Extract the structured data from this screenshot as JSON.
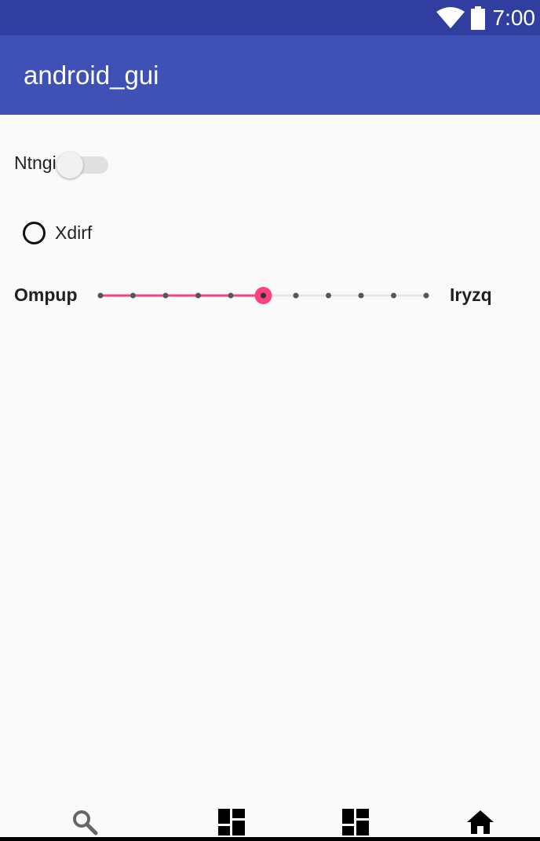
{
  "status_bar": {
    "time": "7:00",
    "icons": [
      "wifi-icon",
      "battery-icon"
    ],
    "background": "#303f9f"
  },
  "app_bar": {
    "title": "android_gui",
    "background": "#3f51b5"
  },
  "switch": {
    "label": "Ntngi",
    "checked": false
  },
  "radio": {
    "label": "Xdirf",
    "selected": false
  },
  "slider": {
    "left_label": "Ompup",
    "right_label": "Iryzq",
    "min": 0,
    "max": 10,
    "value": 5,
    "accent_color": "#ff4081"
  },
  "bottom_nav": {
    "items": [
      {
        "icon": "search-icon"
      },
      {
        "icon": "dashboard-icon"
      },
      {
        "icon": "dashboard-icon"
      },
      {
        "icon": "home-icon"
      }
    ]
  }
}
